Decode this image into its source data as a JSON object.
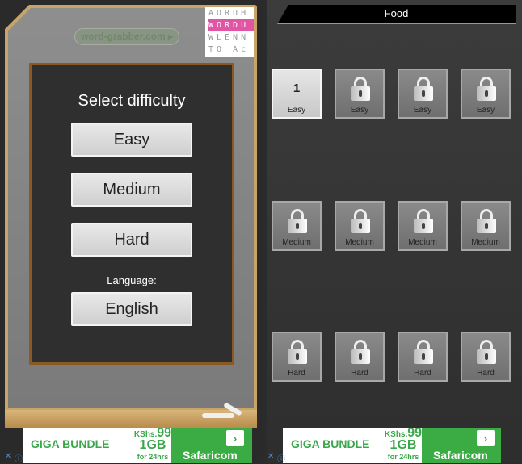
{
  "left": {
    "url_badge": "word-grabber.com ▸",
    "logo_rows": [
      "ADRUH",
      "WORDU",
      "WLENN",
      "TO  Ac"
    ],
    "heading": "Select difficulty",
    "difficulty_buttons": [
      "Easy",
      "Medium",
      "Hard"
    ],
    "language_label": "Language:",
    "language_button": "English"
  },
  "ad": {
    "headline": "GIGA BUNDLE",
    "price_prefix": "KShs.",
    "price": "99",
    "data": "1GB",
    "duration": "for 24hrs",
    "brand": "Safaricom",
    "arrow": "›",
    "close": "✕",
    "info": "ⓘ",
    "brand_color": "#3bab43"
  },
  "right": {
    "header_title": "Food",
    "levels": [
      {
        "label": "Easy",
        "number": "1",
        "locked": false
      },
      {
        "label": "Easy",
        "locked": true
      },
      {
        "label": "Easy",
        "locked": true
      },
      {
        "label": "Easy",
        "locked": true
      },
      {
        "label": "Medium",
        "locked": true
      },
      {
        "label": "Medium",
        "locked": true
      },
      {
        "label": "Medium",
        "locked": true
      },
      {
        "label": "Medium",
        "locked": true
      },
      {
        "label": "Hard",
        "locked": true
      },
      {
        "label": "Hard",
        "locked": true
      },
      {
        "label": "Hard",
        "locked": true
      },
      {
        "label": "Hard",
        "locked": true
      }
    ]
  }
}
